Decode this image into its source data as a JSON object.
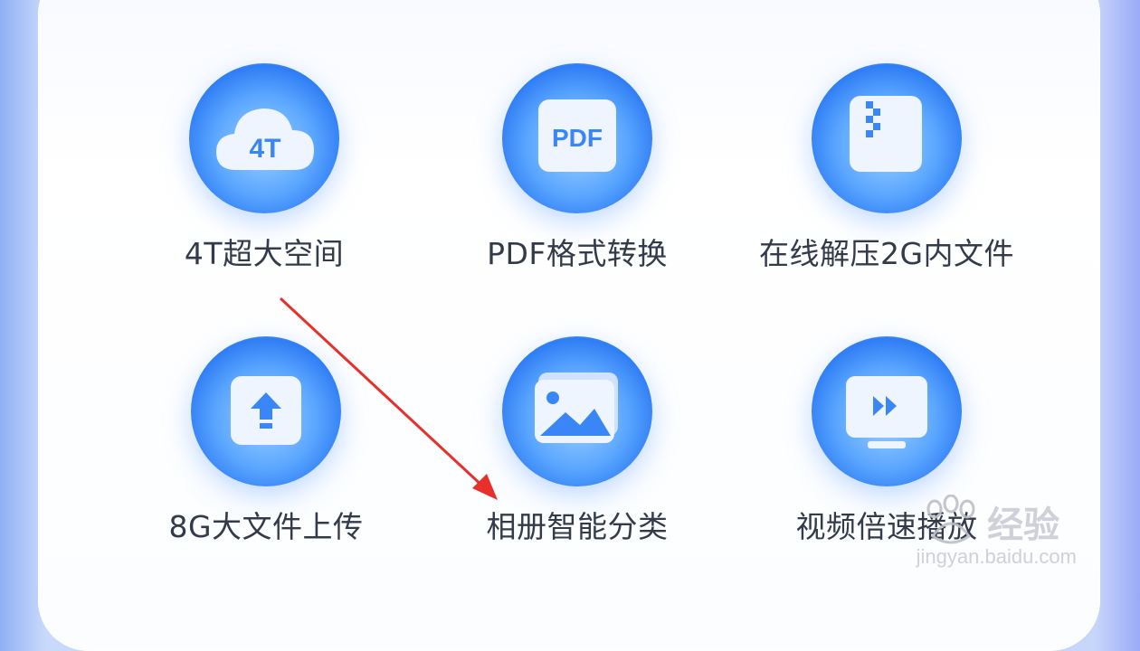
{
  "features": [
    {
      "label": "4T超大空间",
      "icon": "cloud-4t-icon",
      "icon_text": "4T"
    },
    {
      "label": "PDF格式转换",
      "icon": "pdf-icon",
      "icon_text": "PDF"
    },
    {
      "label": "在线解压2G内文件",
      "icon": "zip-file-icon"
    },
    {
      "label": "8G大文件上传",
      "icon": "upload-icon"
    },
    {
      "label": "相册智能分类",
      "icon": "album-icon"
    },
    {
      "label": "视频倍速播放",
      "icon": "video-play-icon"
    }
  ],
  "watermark": {
    "brand": "Bai",
    "text": "经验",
    "url": "jingyan.baidu.com"
  },
  "colors": {
    "accent": "#3a86f7",
    "label": "#333a4a",
    "arrow": "#e8302a"
  }
}
